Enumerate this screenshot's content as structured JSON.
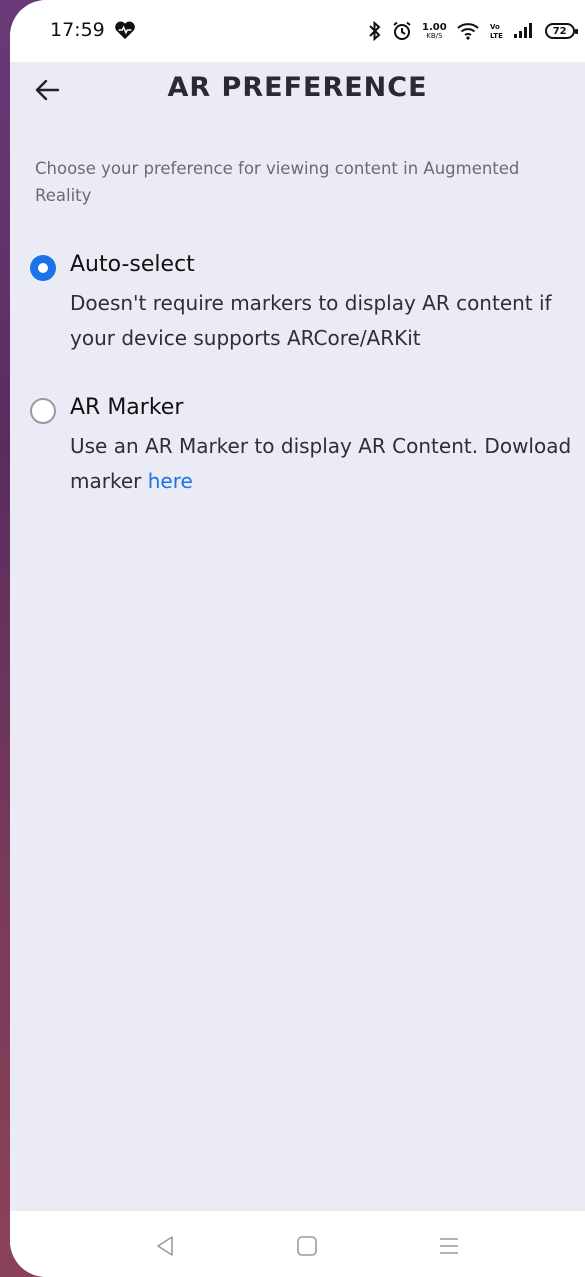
{
  "status_bar": {
    "time": "17:59",
    "network_speed_value": "1.00",
    "network_speed_unit": "KB/S",
    "battery_level": "72"
  },
  "header": {
    "title": "AR PREFERENCE"
  },
  "description": "Choose your preference for viewing content in Augmented Reality",
  "options": [
    {
      "title": "Auto-select",
      "description": "Doesn't require markers to display AR content if your device supports ARCore/ARKit",
      "selected": true
    },
    {
      "title": "AR Marker",
      "description": "Use an AR Marker to display AR Content. Dowload marker ",
      "link_text": "here",
      "selected": false
    }
  ],
  "colors": {
    "accent": "#1a73e8",
    "background": "#ebebf5"
  }
}
